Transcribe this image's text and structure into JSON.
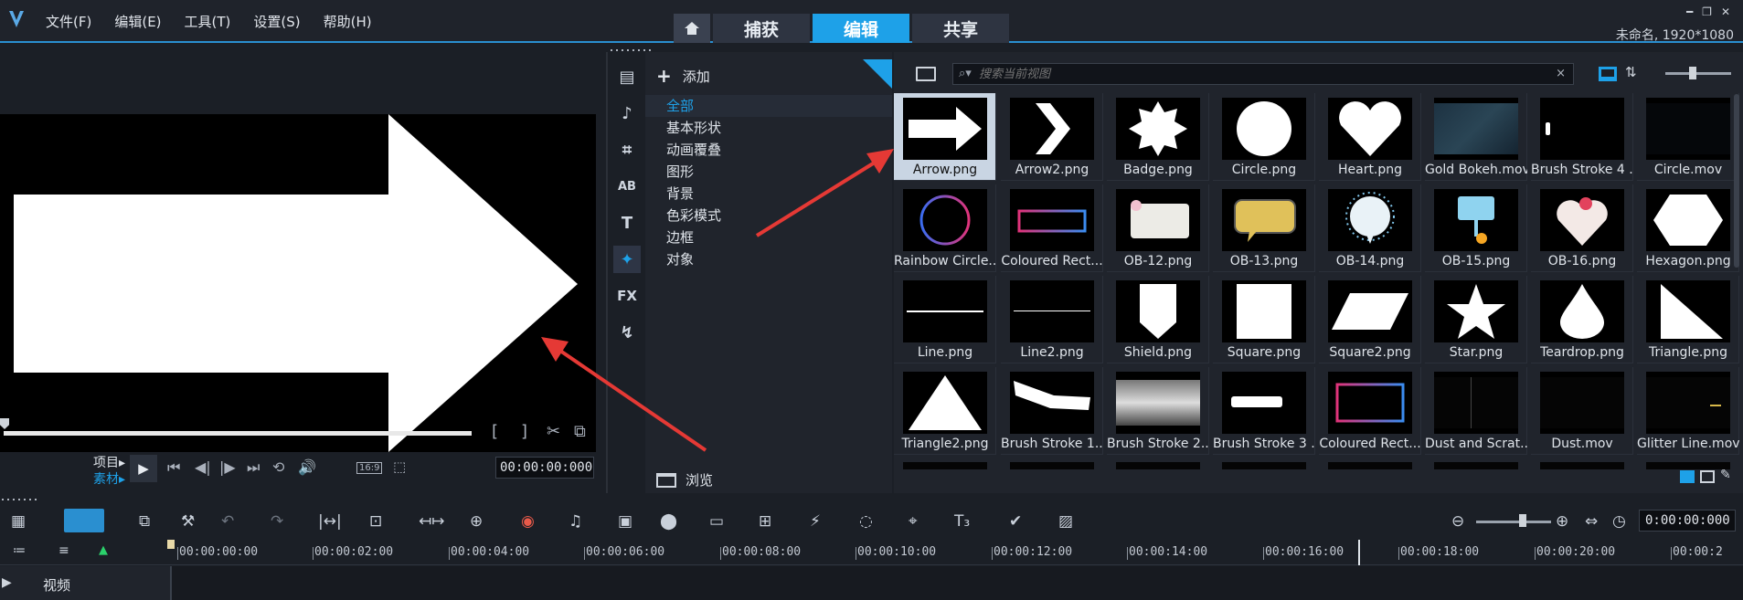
{
  "menu": {
    "file": "文件(F)",
    "edit": "编辑(E)",
    "tools": "工具(T)",
    "settings": "设置(S)",
    "help": "帮助(H)"
  },
  "modes": {
    "capture": "捕获",
    "edit": "编辑",
    "share": "共享"
  },
  "project_info": "未命名, 1920*1080",
  "player": {
    "project_label": "项目▸",
    "clip_label": "素材▸",
    "timecode": "00:00:00:000",
    "aspect": "16:9"
  },
  "categories": {
    "add_label": "添加",
    "items": [
      "全部",
      "基本形状",
      "动画覆叠",
      "图形",
      "背景",
      "色彩模式",
      "边框",
      "对象"
    ],
    "browse_label": "浏览"
  },
  "library": {
    "search_placeholder": "搜索当前视图",
    "tiles": [
      "Arrow.png",
      "Arrow2.png",
      "Badge.png",
      "Circle.png",
      "Heart.png",
      "Gold Bokeh.mov",
      "Brush Stroke 4 ...",
      "Circle.mov",
      "Rainbow Circle...",
      "Coloured Rect...",
      "OB-12.png",
      "OB-13.png",
      "OB-14.png",
      "OB-15.png",
      "OB-16.png",
      "Hexagon.png",
      "Line.png",
      "Line2.png",
      "Shield.png",
      "Square.png",
      "Square2.png",
      "Star.png",
      "Teardrop.png",
      "Triangle.png",
      "Triangle2.png",
      "Brush Stroke 1....",
      "Brush Stroke 2....",
      "Brush Stroke 3 ...",
      "Coloured Rect...",
      "Dust and Scrat...",
      "Dust.mov",
      "Glitter Line.mov"
    ]
  },
  "timeline": {
    "timecode": "0:00:00:000",
    "ruler": [
      "00:00:00:00",
      "00:00:02:00",
      "00:00:04:00",
      "00:00:06:00",
      "00:00:08:00",
      "00:00:10:00",
      "00:00:12:00",
      "00:00:14:00",
      "00:00:16:00",
      "00:00:18:00",
      "00:00:20:00",
      "00:00:2"
    ],
    "track_video": "视频"
  },
  "colors": {
    "accent": "#1ea1e8",
    "annotation": "#e53935",
    "panel": "#20242c",
    "background": "#1b1f26"
  }
}
